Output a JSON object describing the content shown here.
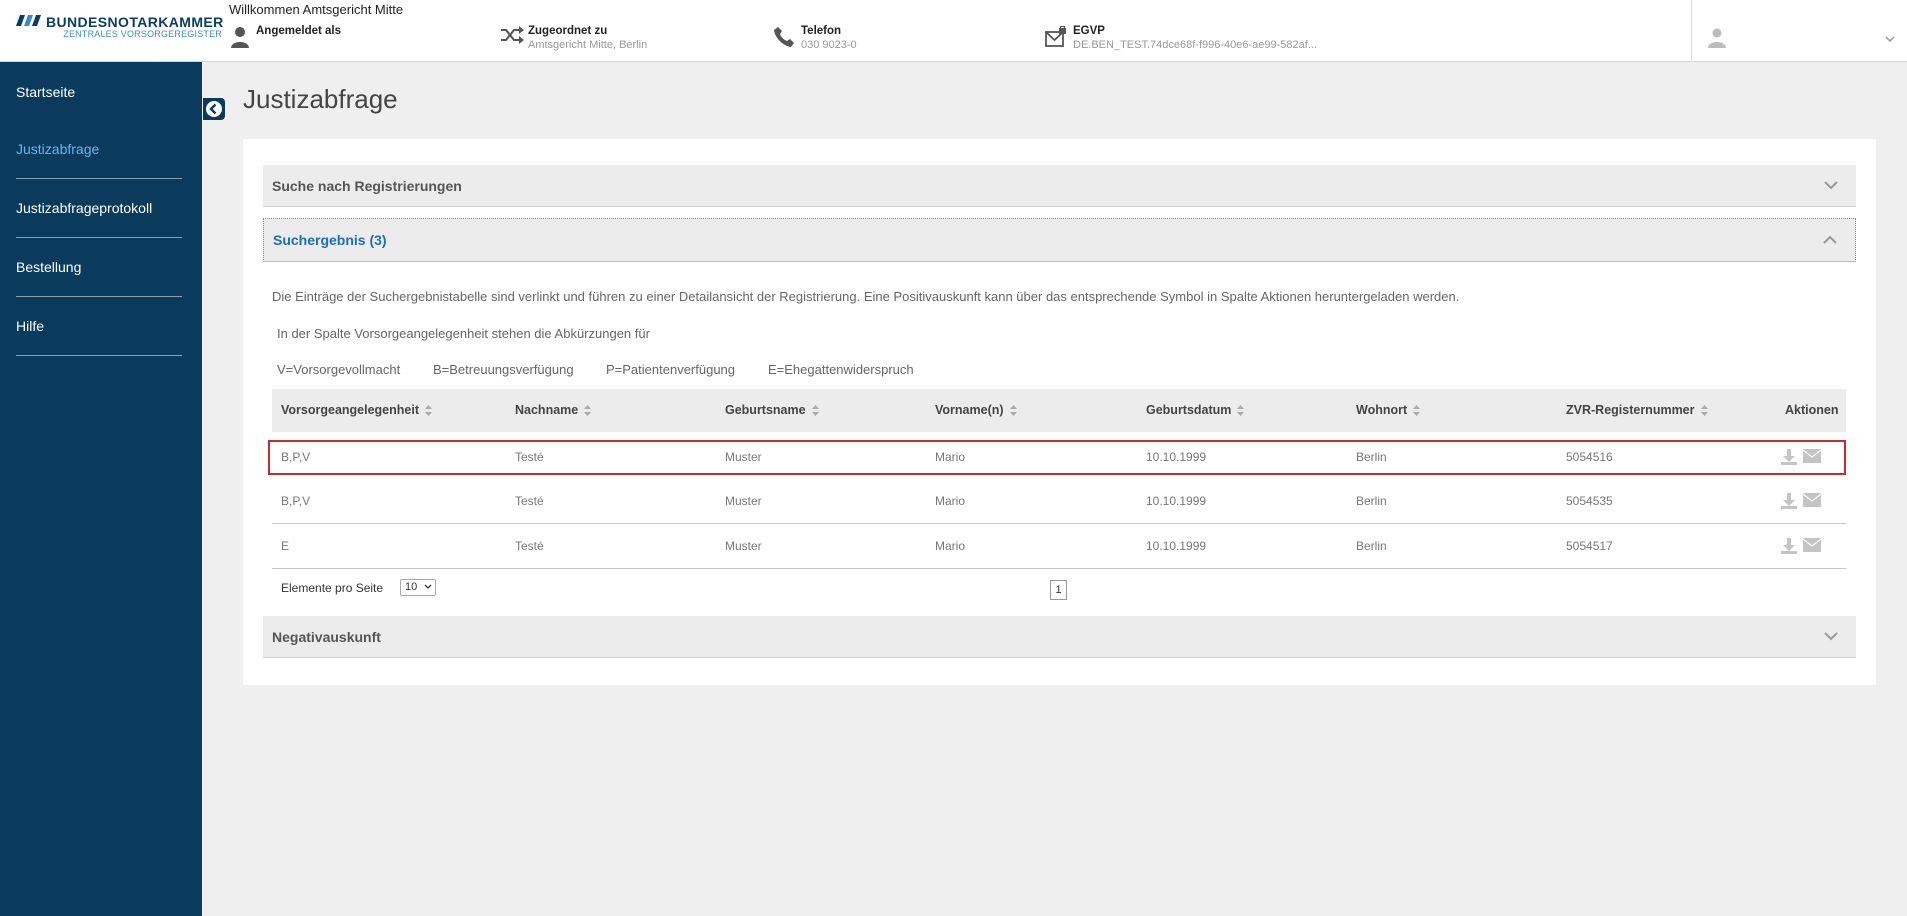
{
  "header": {
    "brand_name": "BUNDESNOTARKAMMER",
    "brand_sub": "ZENTRALES VORSORGEREGISTER",
    "welcome": "Willkommen Amtsgericht Mitte",
    "user_label": "Angemeldet als",
    "user_value": "",
    "assigned_label": "Zugeordnet zu",
    "assigned_value": "Amtsgericht Mitte, Berlin",
    "phone_label": "Telefon",
    "phone_value": "030 9023-0",
    "egvp_label": "EGVP",
    "egvp_value": "DE.BEN_TEST.74dce68f-f996-40e6-ae99-582af..."
  },
  "sidebar": {
    "items": [
      {
        "label": "Startseite"
      },
      {
        "label": "Justizabfrage"
      },
      {
        "label": "Justizabfrageprotokoll"
      },
      {
        "label": "Bestellung"
      },
      {
        "label": "Hilfe"
      }
    ]
  },
  "page": {
    "title": "Justizabfrage"
  },
  "accordion": {
    "search_title": "Suche nach Registrierungen",
    "result_title": "Suchergebnis (3)",
    "negative_title": "Negativauskunft"
  },
  "result": {
    "description": "Die Einträge der Suchergebnistabelle sind verlinkt und führen zu einer Detailansicht der Registrierung. Eine Positivauskunft kann über das entsprechende Symbol in Spalte Aktionen heruntergeladen werden.",
    "abbrev_intro": "In der Spalte Vorsorgeangelegenheit stehen die Abkürzungen für",
    "abbrevs": [
      "V=Vorsorgevollmacht",
      "B=Betreuungsverfügung",
      "P=Patientenverfügung",
      "E=Ehegattenwiderspruch"
    ],
    "columns": [
      "Vorsorgeangelegenheit",
      "Nachname",
      "Geburtsname",
      "Vorname(n)",
      "Geburtsdatum",
      "Wohnort",
      "ZVR-Registernummer",
      "Aktionen"
    ],
    "rows": [
      {
        "type": "B,P,V",
        "nachname": "Testé",
        "geburtsname": "Muster",
        "vorname": "Mario",
        "geburtsdatum": "10.10.1999",
        "wohnort": "Berlin",
        "zvr": "5054516"
      },
      {
        "type": "B,P,V",
        "nachname": "Testé",
        "geburtsname": "Muster",
        "vorname": "Mario",
        "geburtsdatum": "10.10.1999",
        "wohnort": "Berlin",
        "zvr": "5054535"
      },
      {
        "type": "E",
        "nachname": "Testé",
        "geburtsname": "Muster",
        "vorname": "Mario",
        "geburtsdatum": "10.10.1999",
        "wohnort": "Berlin",
        "zvr": "5054517"
      }
    ],
    "page_size_label": "Elemente pro Seite",
    "page_size_value": "10",
    "current_page": "1"
  },
  "colors": {
    "sidebar_bg": "#0a3a5c",
    "active_nav": "#6ab4ee",
    "accent_link": "#1a6fb8",
    "selected_row_border": "#c62d2d"
  },
  "icons": {
    "user": "user-icon",
    "assigned": "shuffle-icon",
    "phone": "phone-icon",
    "egvp": "mail-lock-icon",
    "download": "download-icon",
    "email": "envelope-icon"
  }
}
